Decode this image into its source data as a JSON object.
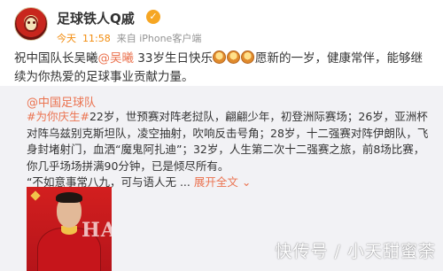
{
  "post": {
    "username": "足球铁人Q戚",
    "verified_badge_icon": "verified-badge-icon",
    "meta": {
      "time_today": "今天",
      "time_clock": "11:58",
      "source": "来自 iPhone客户端"
    },
    "text_before_mention": "祝中国队长吴曦",
    "mention": "@吴曦",
    "text_after_mention": " 33岁生日快乐",
    "text_after_emoji": "愿新的一岁，健康常伴，能够继续为你热爱的足球事业贡献力量。",
    "emoji_icons": [
      "cake-emoji-icon",
      "cake-emoji-icon",
      "cake-emoji-icon"
    ]
  },
  "repost": {
    "author_prefix": "@",
    "author_name": "中国足球队",
    "hashtag": "#为你庆生#",
    "body": "22岁，世预赛对阵老挝队，翩翩少年，初登洲际赛场；26岁，亚洲杯对阵乌兹别克斯坦队，凌空抽射，吹响反击号角；28岁，十二强赛对阵伊朗队，飞身封堵射门，血洒“魔鬼阿扎迪”；32岁，人生第二次十二强赛之旅，前8场比赛，你几乎场场拼满90分钟，已是倾尽所有。",
    "quote_line": "“不如意事常八九，可与语人无 ...",
    "expand_link": "展开全文",
    "expand_icon": "chevron-down-icon",
    "photo_text": "HAPPY"
  },
  "watermark": "快传号 / 小天甜蜜荼"
}
